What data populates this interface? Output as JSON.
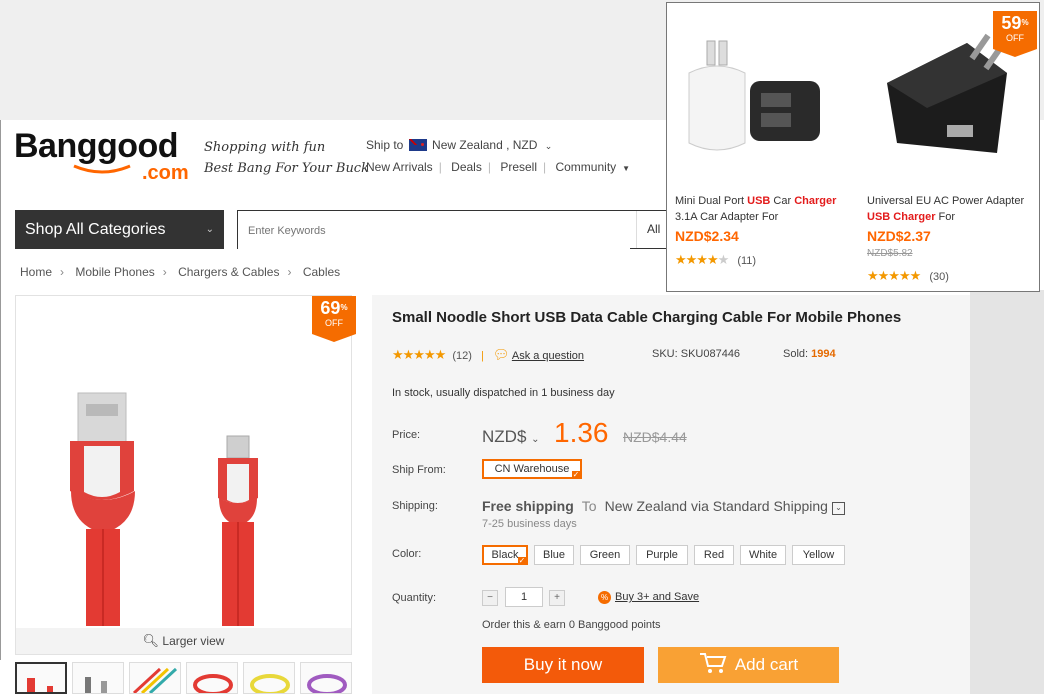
{
  "logo": {
    "word_a": "Bang",
    "word_b": "good",
    "dotcom": ".com"
  },
  "tagline": {
    "line1": "Shopping with fun",
    "line2": "Best Bang For Your Buck"
  },
  "ship": {
    "label": "Ship to",
    "value": "New Zealand , NZD"
  },
  "topnav": [
    "New Arrivals",
    "Deals",
    "Presell",
    "Community"
  ],
  "categories_button": "Shop All Categories",
  "search": {
    "placeholder": "Enter Keywords",
    "scope": "All"
  },
  "breadcrumb": [
    "Home",
    "Mobile Phones",
    "Chargers & Cables",
    "Cables"
  ],
  "gallery": {
    "discount": "69",
    "pct": "%",
    "off": "OFF",
    "larger_view": "Larger view"
  },
  "product": {
    "title": "Small Noodle Short USB Data Cable Charging Cable For Mobile Phones",
    "stars": "★★★★★",
    "reviews": "(12)",
    "ask": "Ask a question",
    "sku": "SKU: SKU087446",
    "sold_label": "Sold:",
    "sold_value": "1994",
    "stock": "In stock, usually dispatched in 1 business day",
    "price_label": "Price:",
    "currency": "NZD$",
    "price": "1.36",
    "old_price": "NZD$4.44",
    "ship_from_label": "Ship From:",
    "ship_from": "CN Warehouse",
    "shipping_label": "Shipping:",
    "free_shipping": "Free shipping",
    "to": "To",
    "destination": "New Zealand via Standard Shipping",
    "days": "7-25 business days",
    "color_label": "Color:",
    "colors": [
      "Black",
      "Blue",
      "Green",
      "Purple",
      "Red",
      "White",
      "Yellow"
    ],
    "selected_color": "Black",
    "quantity_label": "Quantity:",
    "quantity": "1",
    "minus": "−",
    "plus": "+",
    "save_badge": "%",
    "save": "Buy 3+ and Save",
    "points": "Order this & earn 0 Banggood points",
    "buy_now": "Buy it now",
    "add_cart": "Add cart"
  },
  "popup": {
    "discount": "59",
    "pct": "%",
    "off": "OFF",
    "items": [
      {
        "name_a": "Mini Dual Port ",
        "hl1": "USB",
        "name_b": " Car ",
        "hl2": "Charger",
        "name_c": " 3.1A Car Adapter For",
        "price": "NZD$2.34",
        "old": "",
        "stars": "★★★★",
        "grey_stars": "★",
        "reviews": "(11)"
      },
      {
        "name_a": "Universal EU AC Power Adapter ",
        "hl1": "USB",
        "name_b": " ",
        "hl2": "Charger",
        "name_c": " For",
        "price": "NZD$2.37",
        "old": "NZD$5.82",
        "stars": "★★★★★",
        "grey_stars": "",
        "reviews": "(30)"
      }
    ]
  },
  "colors": {
    "accent": "#f60",
    "button_buy": "#f35a0a",
    "button_cart": "#f9a134",
    "stars": "#f39800"
  }
}
